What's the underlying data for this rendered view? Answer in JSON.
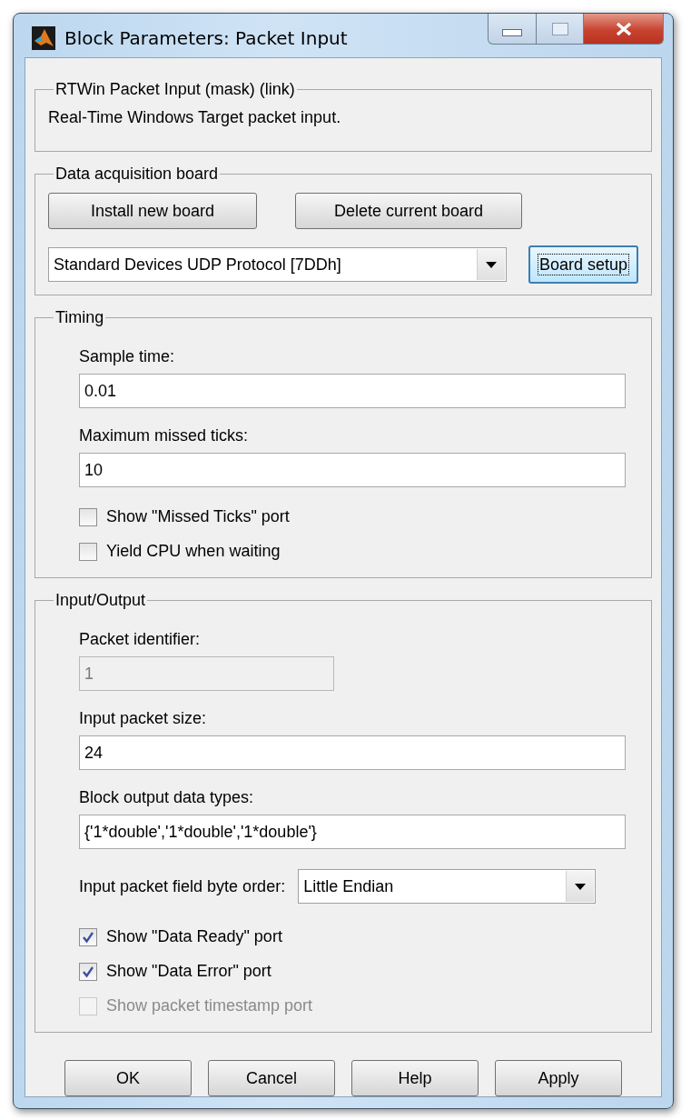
{
  "window": {
    "title": "Block Parameters: Packet Input"
  },
  "groups": [
    {
      "title": "RTWin Packet Input (mask) (link)",
      "items": [
        {
          "kind": "text",
          "text": "Real-Time Windows Target packet input."
        }
      ]
    },
    {
      "title": "Data acquisition board",
      "items": [
        {
          "kind": "buttons",
          "buttons": [
            "Install new board",
            "Delete current board"
          ]
        },
        {
          "kind": "board",
          "value": "Standard Devices UDP Protocol [7DDh]",
          "button": "Board setup"
        }
      ]
    },
    {
      "title": "Timing",
      "items": [
        {
          "kind": "field",
          "label": "Sample time:",
          "value": "0.01",
          "disabled": false,
          "wide": true
        },
        {
          "kind": "field",
          "label": "Maximum missed ticks:",
          "value": "10",
          "disabled": false,
          "wide": true
        },
        {
          "kind": "checkbox",
          "label": "Show \"Missed Ticks\" port",
          "checked": false,
          "disabled": false
        },
        {
          "kind": "checkbox",
          "label": "Yield CPU when waiting",
          "checked": false,
          "disabled": false
        }
      ]
    },
    {
      "title": "Input/Output",
      "items": [
        {
          "kind": "field",
          "label": "Packet identifier:",
          "value": "1",
          "disabled": true,
          "wide": false
        },
        {
          "kind": "field",
          "label": "Input packet size:",
          "value": "24",
          "disabled": false,
          "wide": true
        },
        {
          "kind": "field",
          "label": "Block output data types:",
          "value": "{'1*double','1*double','1*double'}",
          "disabled": false,
          "wide": true
        },
        {
          "kind": "select",
          "label": "Input packet field byte order:",
          "value": "Little Endian"
        },
        {
          "kind": "checkbox",
          "label": "Show \"Data Ready\" port",
          "checked": true,
          "disabled": false
        },
        {
          "kind": "checkbox",
          "label": "Show \"Data Error\" port",
          "checked": true,
          "disabled": false
        },
        {
          "kind": "checkbox",
          "label": "Show packet timestamp port",
          "checked": false,
          "disabled": true
        }
      ]
    }
  ],
  "buttons": [
    "OK",
    "Cancel",
    "Help",
    "Apply"
  ]
}
